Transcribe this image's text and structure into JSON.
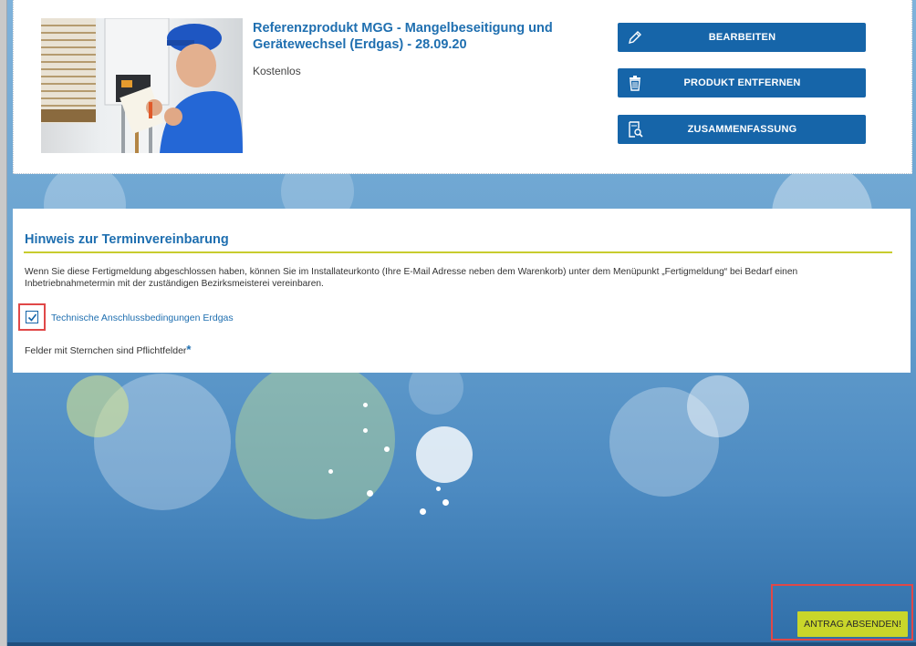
{
  "product": {
    "title": "Referenzprodukt MGG - Mangelbeseitigung und Gerätewechsel (Erdgas) - 28.09.20",
    "price": "Kostenlos",
    "image_icon": "technician-photo"
  },
  "actions": [
    {
      "label": "BEARBEITEN",
      "icon": "pencil-icon"
    },
    {
      "label": "PRODUKT ENTFERNEN",
      "icon": "trash-icon"
    },
    {
      "label": "ZUSAMMENFASSUNG",
      "icon": "document-search-icon"
    }
  ],
  "info": {
    "title": "Hinweis zur Terminvereinbarung",
    "text": "Wenn Sie diese Fertigmeldung abgeschlossen haben, können Sie im Installateurkonto (Ihre E-Mail Adresse neben dem Warenkorb) unter dem Menüpunkt „Fertigmeldung“ bei Bedarf einen Inbetriebnahmetermin mit der zuständigen Bezirksmeisterei vereinbaren.",
    "checkbox_label": "Technische Anschlussbedingungen Erdgas",
    "checkbox_checked": true,
    "required_note": "Felder mit Sternchen sind Pflichtfelder",
    "required_star": "*"
  },
  "submit": {
    "label": "ANTRAG ABSENDEN!"
  },
  "colors": {
    "primary": "#1665a9",
    "accent": "#c9d62a",
    "link": "#1f6fb0",
    "highlight": "#e04848"
  }
}
